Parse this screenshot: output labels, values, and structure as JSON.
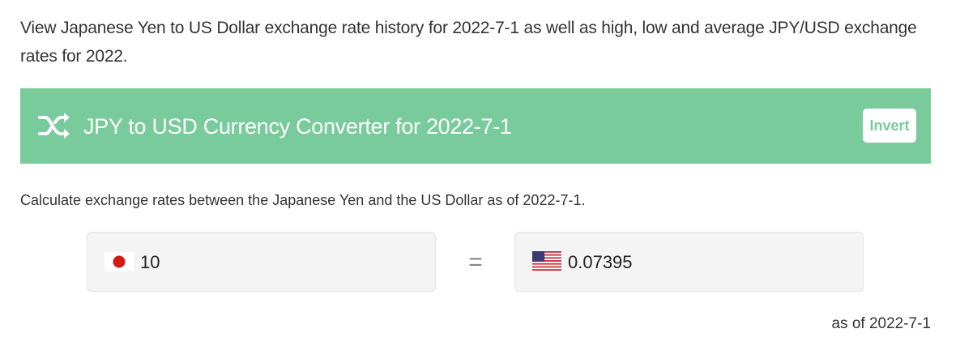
{
  "intro": {
    "text": "View Japanese Yen to US Dollar exchange rate history for 2022-7-1 as well as high, low and average JPY/USD exchange rates for 2022."
  },
  "converter": {
    "title": "JPY to USD Currency Converter for 2022-7-1",
    "icon": "shuffle-icon",
    "invert_label": "Invert",
    "description": "Calculate exchange rates between the Japanese Yen and the US Dollar as of 2022-7-1.",
    "from": {
      "flag": "japan-flag-icon",
      "value": "10"
    },
    "equals": "=",
    "to": {
      "flag": "usa-flag-icon",
      "value": "0.07395"
    },
    "as_of": "as of 2022-7-1"
  },
  "colors": {
    "banner": "#79cb9b",
    "field_bg": "#f4f4f4",
    "text": "#333333"
  }
}
